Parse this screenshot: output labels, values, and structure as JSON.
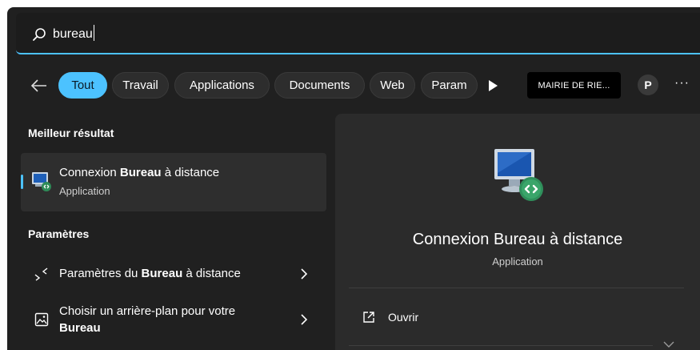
{
  "search": {
    "query": "bureau",
    "icon": "search-icon"
  },
  "filters": {
    "back_icon": "back-arrow-icon",
    "chips": [
      {
        "label": "Tout",
        "active": true
      },
      {
        "label": "Travail",
        "active": false
      },
      {
        "label": "Applications",
        "active": false
      },
      {
        "label": "Documents",
        "active": false
      },
      {
        "label": "Web",
        "active": false
      },
      {
        "label": "Param",
        "active": false
      }
    ],
    "play_icon": "play-icon",
    "org": "MAIRIE DE RIE...",
    "avatar": "P",
    "more": "···"
  },
  "left": {
    "best_title": "Meilleur résultat",
    "best": {
      "name_pre": "Connexion ",
      "name_bold": "Bureau",
      "name_post": " à distance",
      "type": "Application",
      "icon": "remote-desktop-icon"
    },
    "settings_title": "Paramètres",
    "settings": [
      {
        "pre": "Paramètres du ",
        "bold": "Bureau",
        "post": " à distance",
        "icon": "remote-desktop-settings-icon"
      },
      {
        "line1": "Choisir un arrière-plan pour votre",
        "line2": "Bureau",
        "icon": "image-icon"
      }
    ]
  },
  "preview": {
    "title": "Connexion Bureau à distance",
    "subtitle": "Application",
    "action": "Ouvrir",
    "action_icon": "open-external-icon"
  },
  "colors": {
    "accent": "#4cc2ff",
    "panel": "#202020",
    "card": "#2b2b2b"
  }
}
